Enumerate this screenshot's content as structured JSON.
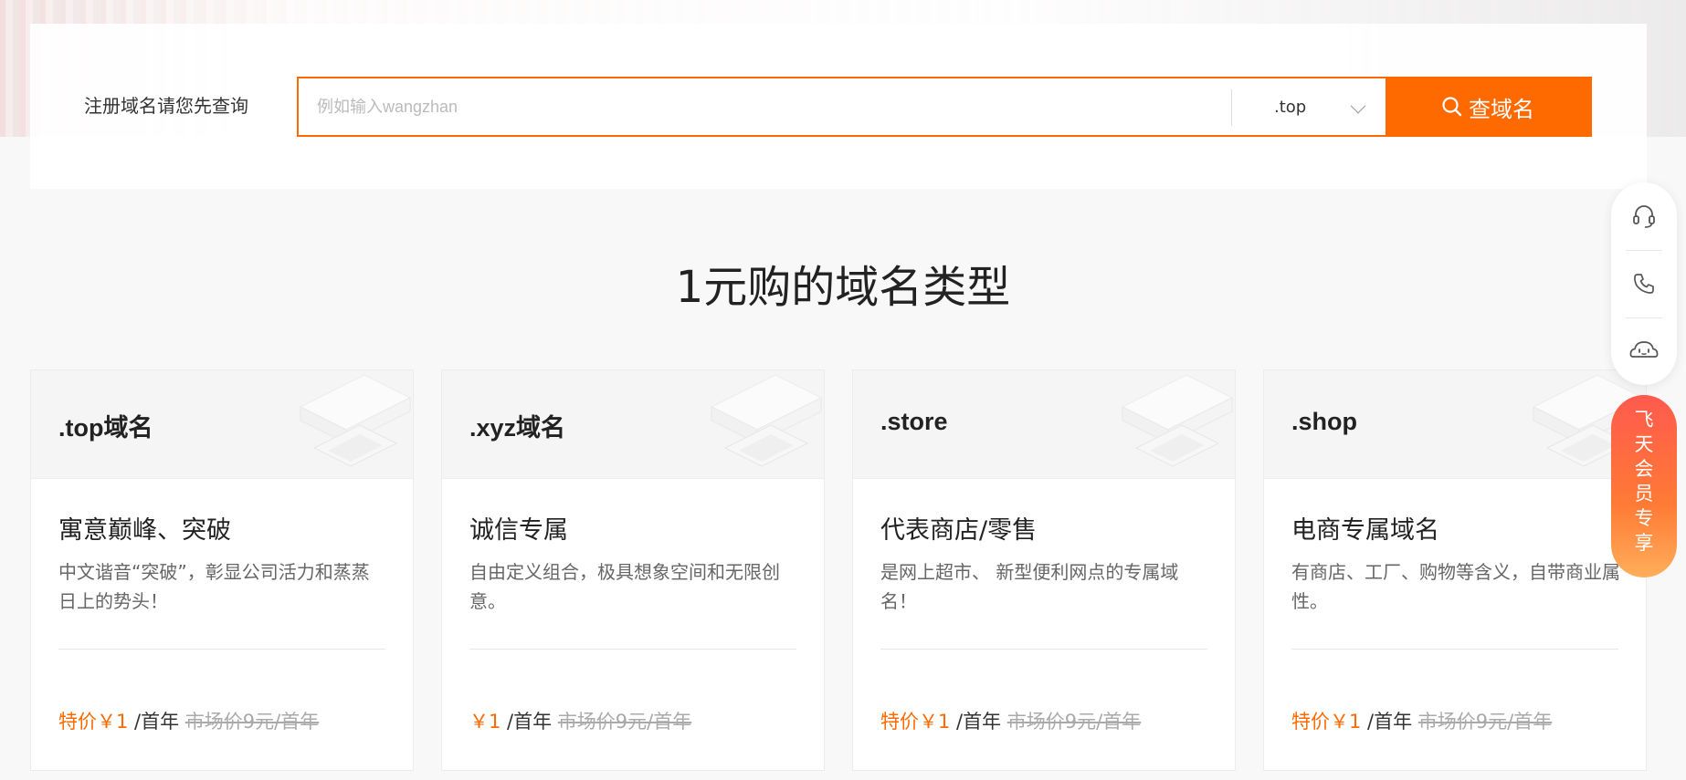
{
  "search": {
    "label": "注册域名请您先查询",
    "placeholder": "例如输入wangzhan",
    "tld_selected": ".top",
    "button_label": "查域名"
  },
  "section": {
    "title": "1元购的域名类型"
  },
  "cards": [
    {
      "name": ".top域名",
      "subtitle": "寓意巅峰、突破",
      "desc": "中文谐音“突破”，彰显公司活力和蒸蒸日上的势头！",
      "special": "特价￥1",
      "unit": " /首年 ",
      "market": "市场价9元/首年"
    },
    {
      "name": ".xyz域名",
      "subtitle": "诚信专属",
      "desc": "自由定义组合，极具想象空间和无限创意。",
      "special": "￥1",
      "unit": " /首年 ",
      "market": "市场价9元/首年"
    },
    {
      "name": ".store",
      "subtitle": "代表商店/零售",
      "desc": "是网上超市、 新型便利网点的专属域名！",
      "special": "特价￥1",
      "unit": " /首年 ",
      "market": "市场价9元/首年"
    },
    {
      "name": ".shop",
      "subtitle": "电商专属域名",
      "desc": "有商店、工厂、购物等含义，自带商业属性。",
      "special": "特价￥1",
      "unit": " /首年 ",
      "market": "市场价9元/首年"
    }
  ],
  "float_bar": {
    "icons": [
      "headset-icon",
      "phone-icon",
      "chat-bot-icon"
    ],
    "vip_label": [
      "飞",
      "天",
      "会",
      "员",
      "专",
      "享"
    ]
  },
  "colors": {
    "accent": "#ff6a00",
    "background": "#f8f8f8"
  }
}
